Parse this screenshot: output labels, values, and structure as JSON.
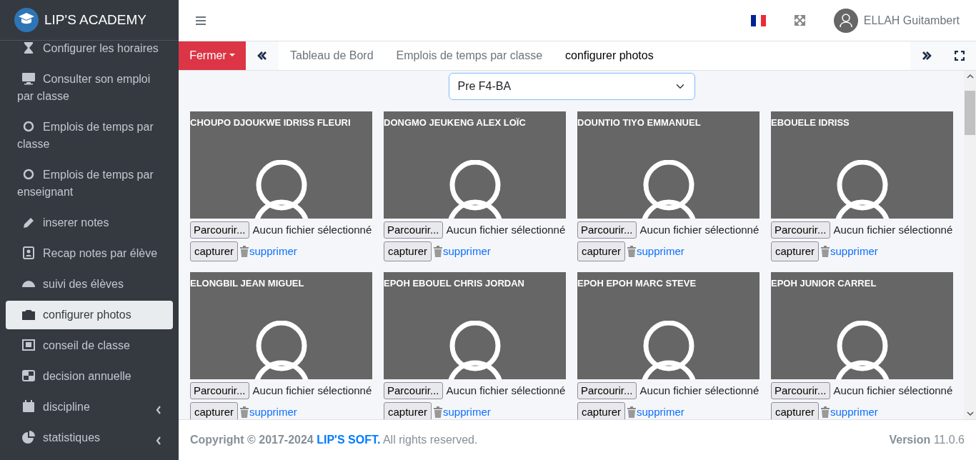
{
  "sidebar": {
    "brand": "LIP'S ACADEMY",
    "items": [
      {
        "label": "Configurer les horaires",
        "kind": "link",
        "selected": false
      },
      {
        "label": "Consulter son emploi par classe",
        "kind": "link",
        "selected": false
      },
      {
        "label": "Emplois de temps par classe",
        "kind": "link",
        "selected": false
      },
      {
        "label": "Emplois de temps par enseignant",
        "kind": "link",
        "selected": false
      },
      {
        "label": "inserer notes",
        "kind": "link",
        "selected": false
      },
      {
        "label": "Recap notes par élève",
        "kind": "link",
        "selected": false
      },
      {
        "label": "suivi des élèves",
        "kind": "link",
        "selected": false
      },
      {
        "label": "configurer photos",
        "kind": "link",
        "selected": true
      },
      {
        "label": "conseil de classe",
        "kind": "link",
        "selected": false
      },
      {
        "label": "decision annuelle",
        "kind": "link",
        "selected": false
      },
      {
        "label": "discipline",
        "kind": "group",
        "selected": false
      },
      {
        "label": "statistiques",
        "kind": "group",
        "selected": false
      }
    ]
  },
  "header": {
    "user": "ELLAH Guitambert"
  },
  "tabbar": {
    "close_label": "Fermer",
    "tabs": [
      {
        "label": "Tableau de Bord",
        "selected": false
      },
      {
        "label": "Emplois de temps par classe",
        "selected": false
      },
      {
        "label": "configurer photos",
        "selected": true
      }
    ]
  },
  "class_select": {
    "value": "Pre F4-BA"
  },
  "students": [
    {
      "name": "CHOUPO DJOUKWE IDRISS FLEURI",
      "browse": "Parcourir...",
      "file_status": "Aucun fichier sélectionné",
      "capture": "capturer",
      "delete": "supprimer"
    },
    {
      "name": "DONGMO JEUKENG ALEX LOÏC",
      "browse": "Parcourir...",
      "file_status": "Aucun fichier sélectionné",
      "capture": "capturer",
      "delete": "supprimer"
    },
    {
      "name": "DOUNTIO TIYO EMMANUEL",
      "browse": "Parcourir...",
      "file_status": "Aucun fichier sélectionné",
      "capture": "capturer",
      "delete": "supprimer"
    },
    {
      "name": "EBOUELE IDRISS",
      "browse": "Parcourir...",
      "file_status": "Aucun fichier sélectionné",
      "capture": "capturer",
      "delete": "supprimer"
    },
    {
      "name": "ELONGBIL JEAN MIGUEL",
      "browse": "Parcourir...",
      "file_status": "Aucun fichier sélectionné",
      "capture": "capturer",
      "delete": "supprimer"
    },
    {
      "name": "EPOH EBOUEL CHRIS JORDAN",
      "browse": "Parcourir...",
      "file_status": "Aucun fichier sélectionné",
      "capture": "capturer",
      "delete": "supprimer"
    },
    {
      "name": "EPOH EPOH MARC STEVE",
      "browse": "Parcourir...",
      "file_status": "Aucun fichier sélectionné",
      "capture": "capturer",
      "delete": "supprimer"
    },
    {
      "name": "EPOH JUNIOR CARREL",
      "browse": "Parcourir...",
      "file_status": "Aucun fichier sélectionné",
      "capture": "capturer",
      "delete": "supprimer"
    }
  ],
  "footer": {
    "copyright": "Copyright © 2017-2024",
    "company": "LIP'S SOFT.",
    "rights": "All rights reserved.",
    "version": "**Version** 11.0.6"
  }
}
